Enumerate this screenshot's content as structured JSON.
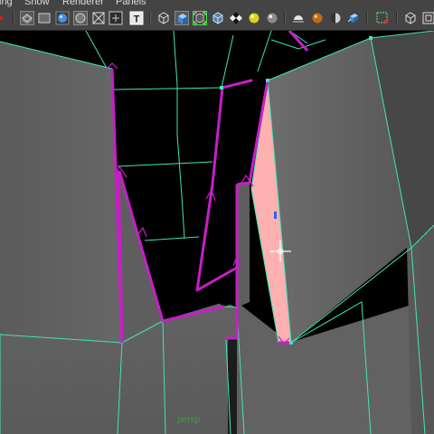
{
  "menu": {
    "items": [
      "ing",
      "Show",
      "Renderer",
      "Panels"
    ]
  },
  "toolbar": {
    "buttons": [
      {
        "name": "keyframe-icon"
      },
      {
        "name": "wireframe-on-shaded-icon"
      },
      {
        "name": "film-gate-icon"
      },
      {
        "name": "sphere-shading-icon"
      },
      {
        "name": "resolution-gate-icon"
      },
      {
        "name": "safe-area-icon"
      },
      {
        "name": "texture-icon"
      },
      {
        "name": "wireframe-cube-icon"
      },
      {
        "name": "smooth-shade-cube-icon"
      },
      {
        "name": "isolate-select-icon"
      },
      {
        "name": "bounding-box-cube-icon"
      },
      {
        "name": "checker-texture-icon"
      },
      {
        "name": "default-light-icon"
      },
      {
        "name": "lighting-sphere-icon"
      },
      {
        "name": "shadows-icon"
      },
      {
        "name": "material-sphere-icon"
      },
      {
        "name": "half-sphere-icon"
      },
      {
        "name": "render-cube-icon"
      },
      {
        "name": "xray-select-icon"
      },
      {
        "name": "cube-view-icon"
      },
      {
        "name": "panel-layout-icon"
      }
    ],
    "texture_button_text": "T"
  },
  "viewport": {
    "camera": "persp",
    "colors": {
      "background": "#000000",
      "wire": "#3fe6b4",
      "selected_edge": "#c81ec8",
      "selected_face": "#ffb0b0",
      "surface": "#5f5f5f",
      "camera_label": "#2ea82e"
    }
  }
}
